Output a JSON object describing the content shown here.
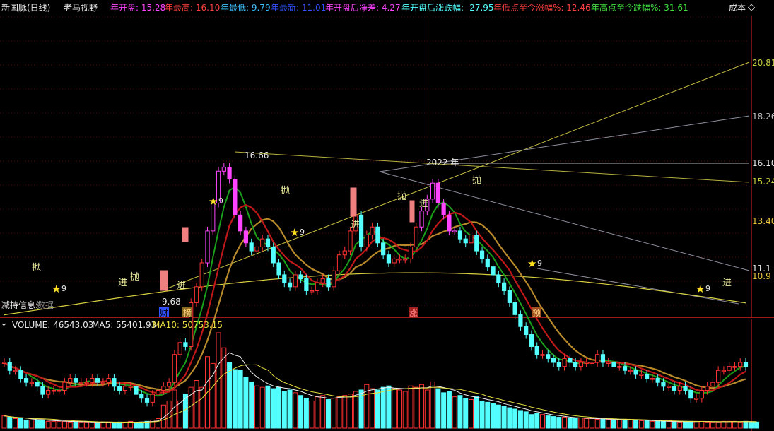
{
  "header": {
    "stock": "新国脉(日线)",
    "indicator": "老马视野",
    "year_open_label": "年开盘: 15.28",
    "year_high_label": "年最高: 16.10",
    "year_low_label": "年最低: 9.79",
    "year_close_label": "年最新: 11.01",
    "net_diff_label": "年开盘后净差: 4.27",
    "pct_label": "年开盘后涨跌幅: -27.95",
    "from_low_label": "年低点至今涨幅%: 12.46",
    "from_high_label": "年高点至今跌幅%: 31.61",
    "cost_label": "成本",
    "cost_icon": "diamond-outline-icon"
  },
  "price_panel": {
    "price_levels": [
      "20.81",
      "18.26",
      "16.10",
      "15.24",
      "13.40",
      "11.1",
      "10.9"
    ],
    "high_label": "16.66",
    "low_label": "9.68",
    "year_label": "2022 年",
    "reduce_info": "减持信息:",
    "reduce_info_tail": "数据",
    "event_markers": [
      "财",
      "榜",
      "涨",
      "预"
    ],
    "signal_sell": "抛",
    "signal_buy": "进",
    "star_count": "9"
  },
  "volume_panel": {
    "label": "VOLUME: 46543.03",
    "ma5_label": "MA5: 55401.93",
    "ma10_label": "MA10: 50753.15"
  },
  "colors": {
    "up": "#ff3232",
    "down": "#54ffff",
    "magenta": "#ff44ff",
    "ma_red": "#c01818",
    "ma_green": "#1aa01a",
    "ma_gold": "#b88a2a",
    "ma_yellow": "#d8d040"
  },
  "chart_data": {
    "type": "candlestick",
    "price_levels": [
      20.81,
      18.26,
      16.1,
      15.24,
      13.4,
      11.1,
      10.9
    ],
    "ylim": [
      9.0,
      22.0
    ],
    "high": 16.66,
    "low": 9.68,
    "volume_last": 46543.03,
    "volume_ma5": 55401.93,
    "volume_ma10": 50753.15,
    "close_series": [
      11.1,
      10.9,
      10.9,
      10.7,
      10.6,
      10.6,
      10.5,
      10.3,
      10.4,
      10.4,
      10.4,
      10.6,
      10.7,
      10.6,
      10.6,
      10.6,
      10.7,
      10.6,
      10.6,
      10.7,
      10.5,
      10.4,
      10.5,
      10.5,
      10.3,
      10.2,
      10.1,
      10.3,
      10.4,
      10.5,
      10.6,
      11.3,
      11.6,
      11.5,
      12.6,
      13.0,
      13.6,
      14.4,
      15.1,
      15.9,
      16.0,
      15.7,
      14.8,
      14.4,
      14.1,
      13.9,
      14.0,
      14.2,
      14.0,
      13.6,
      13.3,
      13.1,
      13.0,
      13.3,
      13.2,
      12.9,
      12.9,
      13.1,
      13.2,
      13.0,
      13.4,
      13.8,
      13.9,
      14.4,
      14.8,
      14.0,
      14.3,
      14.5,
      14.1,
      13.8,
      13.6,
      13.7,
      13.7,
      13.7,
      14.0,
      14.5,
      14.9,
      15.2,
      15.6,
      15.1,
      14.8,
      14.4,
      14.4,
      14.2,
      14.1,
      14.3,
      13.9,
      13.7,
      13.5,
      13.3,
      13.1,
      12.9,
      12.6,
      12.3,
      12.0,
      11.8,
      11.5,
      11.3,
      11.3,
      11.2,
      11.1,
      11.0,
      11.2,
      11.1,
      11.0,
      11.1,
      11.1,
      11.1,
      11.3,
      11.1,
      11.1,
      11.0,
      11.0,
      10.9,
      10.9,
      10.8,
      10.8,
      10.7,
      10.7,
      10.6,
      10.5,
      10.5,
      10.4,
      10.5,
      10.4,
      10.2,
      10.2,
      10.4,
      10.5,
      10.6,
      10.9,
      10.9,
      11.0,
      11.0,
      11.1,
      11.0
    ],
    "volume_series": [
      18,
      16,
      14,
      14,
      12,
      12,
      12,
      12,
      10,
      10,
      10,
      10,
      9,
      10,
      9,
      9,
      8,
      8,
      9,
      9,
      8,
      9,
      9,
      10,
      8,
      9,
      10,
      12,
      14,
      34,
      40,
      56,
      40,
      50,
      60,
      70,
      60,
      105,
      95,
      140,
      118,
      96,
      86,
      85,
      75,
      68,
      62,
      60,
      62,
      58,
      60,
      54,
      56,
      52,
      48,
      44,
      40,
      46,
      48,
      42,
      44,
      46,
      48,
      50,
      54,
      56,
      64,
      58,
      56,
      60,
      62,
      58,
      56,
      54,
      62,
      60,
      64,
      56,
      68,
      58,
      52,
      54,
      46,
      48,
      44,
      42,
      46,
      40,
      38,
      36,
      34,
      32,
      30,
      28,
      26,
      24,
      20,
      22,
      20,
      18,
      17,
      16,
      16,
      14,
      14,
      15,
      14,
      14,
      13,
      13,
      13,
      12,
      12,
      12,
      12,
      12,
      11,
      11,
      10,
      10,
      10,
      10,
      9,
      9,
      10,
      10,
      10,
      10,
      9,
      9,
      9,
      10,
      10,
      10,
      9,
      10,
      9,
      9
    ],
    "xlabel": "",
    "ylabel": ""
  }
}
